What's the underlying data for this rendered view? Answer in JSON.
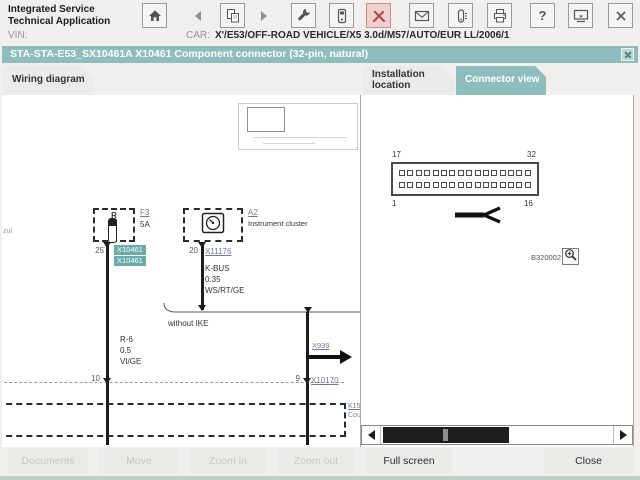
{
  "app": {
    "title_line1": "Integrated Service",
    "title_line2": "Technical Application"
  },
  "toolbar": {
    "icons": [
      "home",
      "back",
      "workshop-documents",
      "forward",
      "service-wrench",
      "measuring-device",
      "vehicle-service-active",
      "mail",
      "battery-test",
      "print",
      "help",
      "display",
      "close"
    ],
    "help_glyph": "?"
  },
  "header": {
    "vin_label": "VIN:",
    "car_label": "CAR:",
    "car_value": "X'/E53/OFF-ROAD VEHICLE/X5 3.0d/M57/AUTO/EUR LL/2006/1"
  },
  "dialog": {
    "title": "STA-STA-E53_SX10461A X10461 Component connector (32-pin, natural)"
  },
  "tabs": {
    "wiring": "Wiring diagram",
    "installation_line1": "Installation",
    "installation_line2": "location",
    "connector": "Connector view"
  },
  "diagram": {
    "edge_left_label": "zul",
    "fuse": {
      "ref": "R",
      "link": "F3",
      "rating": "5A",
      "pin": "25",
      "connector_labels": [
        "X10461",
        "X10461"
      ],
      "wire": [
        "R-6",
        "0.5",
        "VI/GE"
      ],
      "bottom_pin": "10"
    },
    "cluster": {
      "link": "A2",
      "name": "Instrument cluster",
      "pin": "20",
      "connector": "X11176",
      "wire": [
        "K-BUS",
        "0.35",
        "WS/RT/GE"
      ]
    },
    "branch": {
      "note": "without IKE",
      "arrow_link": "X939",
      "bottom_pin": "9",
      "bottom_connector": "X10170"
    },
    "boundary": {
      "link": "K15",
      "label": "Cou"
    }
  },
  "connector_view": {
    "rows": 2,
    "cols": 16,
    "pin_top_left": "17",
    "pin_top_right": "32",
    "pin_bottom_left": "1",
    "pin_bottom_right": "16",
    "figure_id": "B320002"
  },
  "buttons": {
    "documents": "Documents",
    "move": "Move",
    "zoom_in": "Zoom in",
    "zoom_out": "Zoom out",
    "full_screen": "Full screen",
    "close": "Close"
  },
  "colors": {
    "teal": "#8fbdbd",
    "highlight": "#6aabab",
    "link": "#6f7aa3",
    "alert_red": "#b04848"
  }
}
